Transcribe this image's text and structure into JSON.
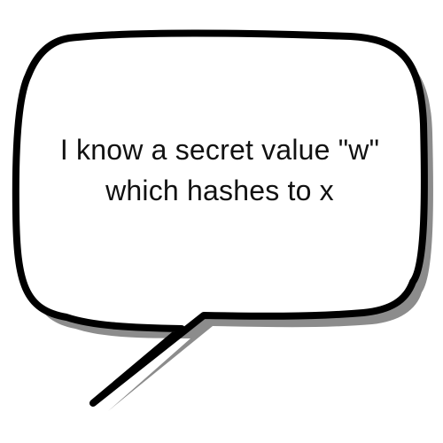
{
  "speech_bubble": {
    "line_1": "I know a secret value \"w\"",
    "line_2": "which hashes to x"
  },
  "colors": {
    "background": "#ffffff",
    "bubble_fill": "#ffffff",
    "bubble_outline": "#000000",
    "bubble_shadow": "#8c8c8c",
    "text": "#111111"
  }
}
